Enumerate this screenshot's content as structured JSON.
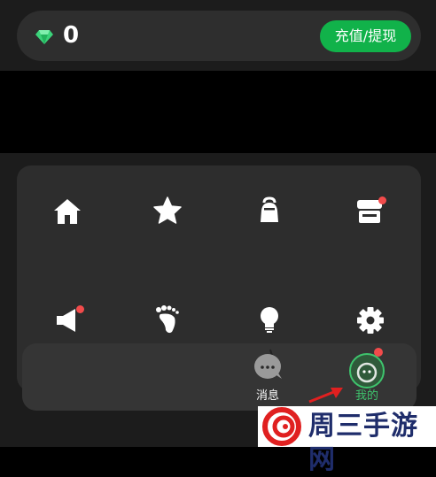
{
  "wallet": {
    "balance": "0",
    "recharge_label": "充值/提现",
    "gem_icon": "diamond-icon",
    "accent": "#11b24a"
  },
  "grid": {
    "row1": [
      "home-icon",
      "star-icon",
      "bell-icon",
      "store-icon"
    ],
    "row2": [
      "megaphone-icon",
      "footprint-icon",
      "lightbulb-icon",
      "gear-icon"
    ],
    "badge_color": "#f24b4b"
  },
  "tabbar": {
    "messages_label": "消息",
    "mine_label": "我的",
    "active_color": "#3ec46d"
  },
  "watermark": {
    "text": "周三手游网"
  }
}
